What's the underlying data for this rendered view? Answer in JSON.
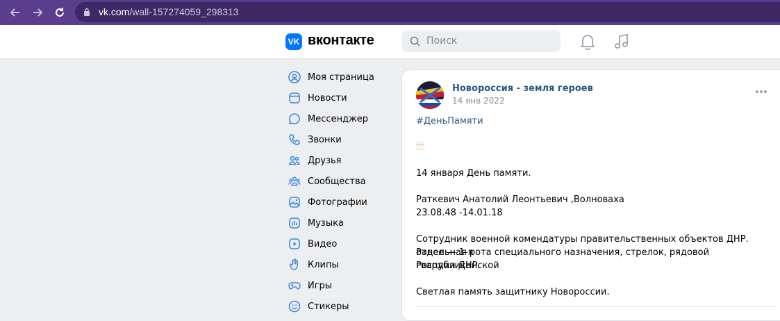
{
  "browser": {
    "url_host": "vk.com",
    "url_path": "/wall-157274059_298313"
  },
  "header": {
    "logo_text": "VK",
    "wordmark": "вконтакте",
    "search_placeholder": "Поиск"
  },
  "sidebar": {
    "items": [
      {
        "label": "Моя страница",
        "icon": "user-icon"
      },
      {
        "label": "Новости",
        "icon": "news-icon"
      },
      {
        "label": "Мессенджер",
        "icon": "message-icon"
      },
      {
        "label": "Звонки",
        "icon": "phone-icon"
      },
      {
        "label": "Друзья",
        "icon": "friends-icon"
      },
      {
        "label": "Сообщества",
        "icon": "communities-icon"
      },
      {
        "label": "Фотографии",
        "icon": "photo-icon"
      },
      {
        "label": "Музыка",
        "icon": "music-icon"
      },
      {
        "label": "Видео",
        "icon": "video-icon"
      },
      {
        "label": "Клипы",
        "icon": "clips-icon"
      },
      {
        "label": "Игры",
        "icon": "games-icon"
      },
      {
        "label": "Стикеры",
        "icon": "stickers-icon"
      }
    ]
  },
  "post": {
    "author": "Новороссия - земля героев",
    "date": "14 янв 2022",
    "hashtag": "#ДеньПамяти",
    "candles": "🕯🕯🕯",
    "line1": "14 января День памяти.",
    "line2": "Раткевич Анатолий Леонтьевич ,Волноваха",
    "line3": "23.08.48 -14.01.18",
    "line4": "Сотрудник военной комендатуры правительственных объектов ДНР. Ранее — 1-я",
    "line5": "отдельная рота специального назначения, стрелок, рядовой Республиканской",
    "line6": "гвардии ДНР.",
    "line7": "Светлая память защитнику Новороссии."
  },
  "colors": {
    "browser_bar": "#5b3d8d",
    "vk_blue": "#0077ff",
    "link": "#2a5885",
    "background": "#edeef0"
  }
}
